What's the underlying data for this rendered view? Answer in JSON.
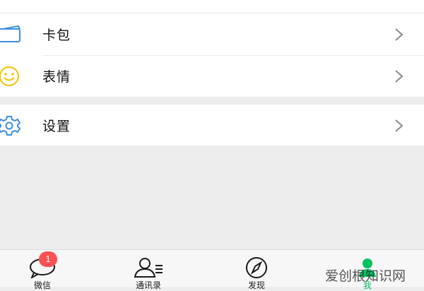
{
  "menu": {
    "group1": [
      {
        "label": "卡包",
        "icon": "card-wallet-icon",
        "color": "#3d8fe0"
      },
      {
        "label": "表情",
        "icon": "smiley-icon",
        "color": "#f2c300"
      }
    ],
    "group2": [
      {
        "label": "设置",
        "icon": "settings-gear-icon",
        "color": "#3d8fe0"
      }
    ]
  },
  "tabbar": {
    "tabs": [
      {
        "label": "微信",
        "icon": "chat-bubble-icon",
        "badge": "1"
      },
      {
        "label": "通讯录",
        "icon": "contacts-icon"
      },
      {
        "label": "发现",
        "icon": "compass-icon"
      },
      {
        "label": "我",
        "icon": "me-person-icon",
        "active": true
      }
    ]
  },
  "colors": {
    "accent": "#07c160",
    "badge": "#fa5151",
    "background": "#ededed"
  },
  "watermark": "爱创根知识网"
}
